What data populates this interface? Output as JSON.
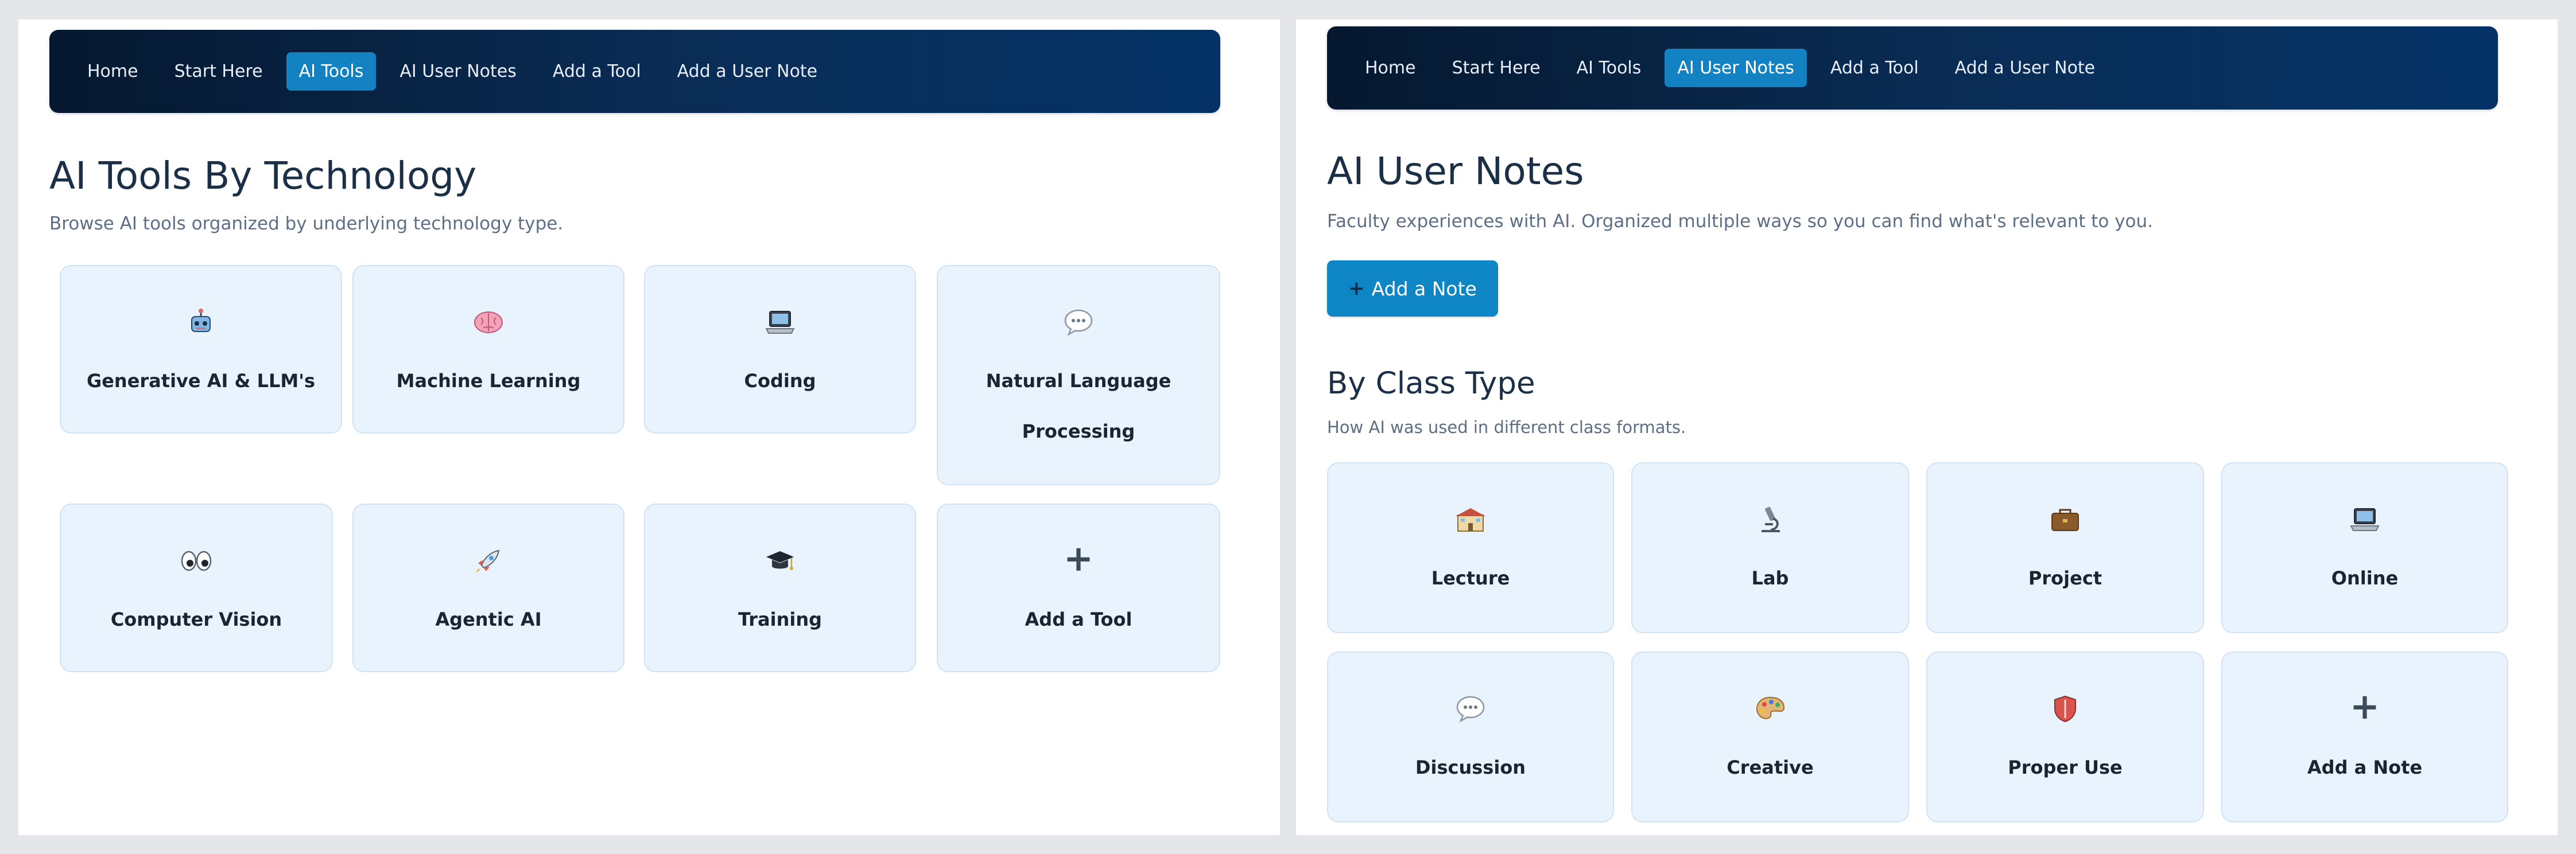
{
  "left": {
    "nav": [
      "Home",
      "Start Here",
      "AI Tools",
      "AI User Notes",
      "Add a Tool",
      "Add a User Note"
    ],
    "title": "AI Tools By Technology",
    "subtitle": "Browse AI tools organized by underlying technology type.",
    "cards": [
      {
        "icon": "robot-icon",
        "label": "Generative AI & LLM's"
      },
      {
        "icon": "brain-icon",
        "label": "Machine Learning"
      },
      {
        "icon": "laptop-icon",
        "label": "Coding"
      },
      {
        "icon": "speech-bubble-icon",
        "label": "Natural Language Processing"
      },
      {
        "icon": "eyes-icon",
        "label": "Computer Vision"
      },
      {
        "icon": "rocket-icon",
        "label": "Agentic AI"
      },
      {
        "icon": "graduation-cap-icon",
        "label": "Training"
      },
      {
        "icon": "plus-icon",
        "label": "Add a Tool",
        "glyph": "+"
      }
    ]
  },
  "right": {
    "nav": [
      "Home",
      "Start Here",
      "AI Tools",
      "AI User Notes",
      "Add a Tool",
      "Add a User Note"
    ],
    "title": "AI User Notes",
    "subtitle": "Faculty experiences with AI. Organized multiple ways so you can find what's relevant to you.",
    "add_button_label": "Add a Note",
    "add_button_plus": "+",
    "section_title": "By Class Type",
    "section_subtitle": "How AI was used in different class formats.",
    "cards": [
      {
        "icon": "school-building-icon",
        "label": "Lecture"
      },
      {
        "icon": "microscope-icon",
        "label": "Lab"
      },
      {
        "icon": "briefcase-icon",
        "label": "Project"
      },
      {
        "icon": "laptop-icon",
        "label": "Online"
      },
      {
        "icon": "speech-bubble-icon",
        "label": "Discussion"
      },
      {
        "icon": "palette-icon",
        "label": "Creative"
      },
      {
        "icon": "shield-icon",
        "label": "Proper Use"
      },
      {
        "icon": "plus-icon",
        "label": "Add a Note",
        "glyph": "+"
      }
    ]
  },
  "colors": {
    "nav_active": "#1282c2",
    "nav_gradient_start": "#05182f",
    "nav_gradient_end": "#043266",
    "card_bg": "#e8f3fd",
    "button_bg": "#0e86c6",
    "title_text": "#1b2f47"
  }
}
